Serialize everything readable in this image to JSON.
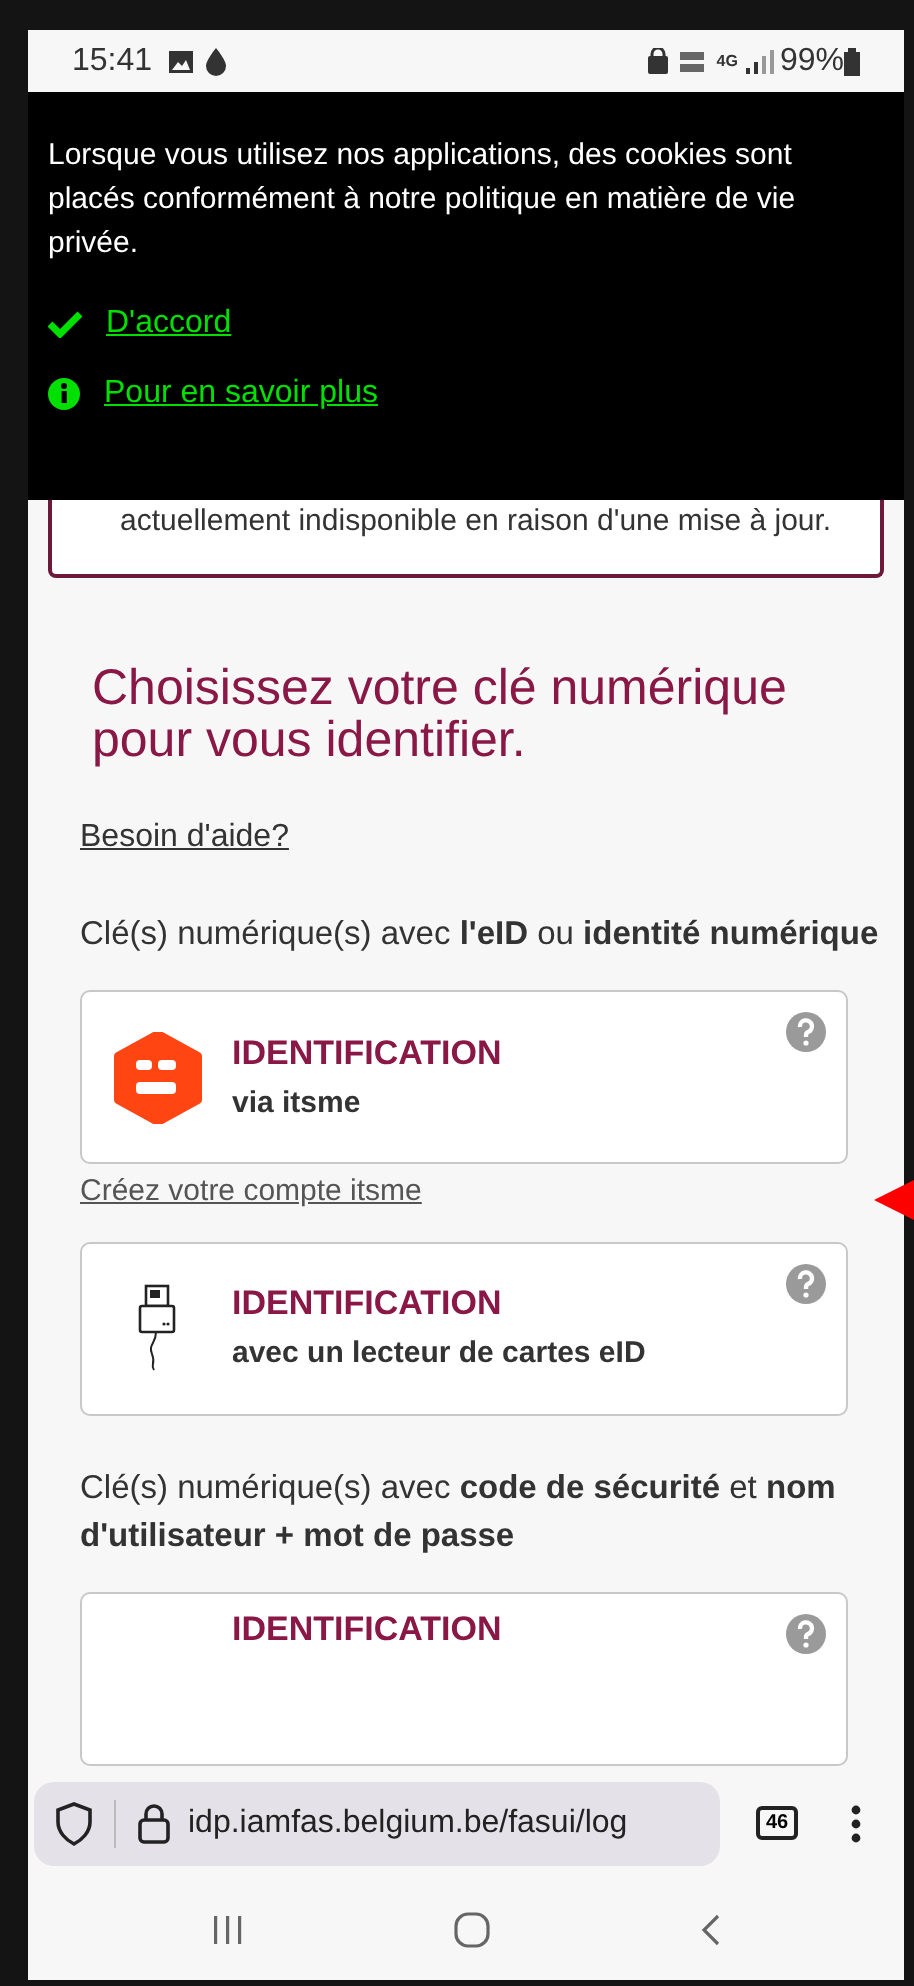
{
  "status_bar": {
    "time": "15:41",
    "network": "4G",
    "battery": "99%"
  },
  "cookie_banner": {
    "message": "Lorsque vous utilisez nos applications, des cookies sont placés conformément à notre politique en matière de vie privée.",
    "links": [
      {
        "kind": "accept",
        "label": "D'accord"
      },
      {
        "kind": "info",
        "label": "Pour en savoir plus"
      }
    ]
  },
  "alert": {
    "text": "actuellement indisponible en raison d'une mise à jour."
  },
  "heading": "Choisissez votre clé numérique pour vous identifier.",
  "help_link": "Besoin d'aide?",
  "sections": [
    {
      "title": "Clé(s) numérique(s) avec **l'eID** ou **identité numérique**",
      "options": [
        {
          "kind": "itsme",
          "title": "IDENTIFICATION",
          "subtitle": "via itsme",
          "link": "Créez votre compte itsme"
        },
        {
          "kind": "reader",
          "title": "IDENTIFICATION",
          "subtitle": "avec un lecteur de cartes eID"
        }
      ]
    },
    {
      "title": "Clé(s) numérique(s) avec **code de sécurité** et **nom d'utilisateur + mot de passe**",
      "options": [
        {
          "kind": "partial",
          "title": "IDENTIFICATION"
        }
      ]
    }
  ],
  "browser_bar": {
    "url": "idp.iamfas.belgium.be/fasui/log",
    "tab_count": "46"
  }
}
